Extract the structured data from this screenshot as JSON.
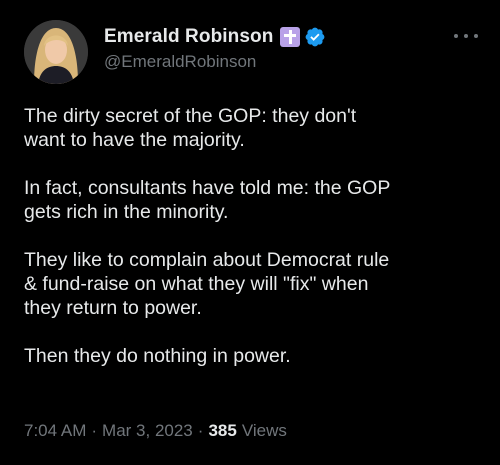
{
  "author": {
    "display_name": "Emerald Robinson",
    "handle": "@EmeraldRobinson",
    "avatar_icon": "profile-photo",
    "badges": [
      "cross-icon",
      "verified-icon"
    ],
    "colors": {
      "verified": "#1d9bf0",
      "cross_badge": "#b9a2e8"
    }
  },
  "more_icon": "ellipsis-icon",
  "tweet": {
    "paragraphs": [
      "The dirty secret of the GOP: they don't\nwant to have the majority.",
      "In fact, consultants have told me: the GOP\ngets rich in the minority.",
      "They like to complain about Democrat rule\n& fund-raise on what they will \"fix\" when\nthey return to power.",
      "Then they do nothing in power."
    ]
  },
  "meta": {
    "time": "7:04 AM",
    "separator": "·",
    "date": "Mar 3, 2023",
    "views_count": "385",
    "views_label": "Views"
  }
}
